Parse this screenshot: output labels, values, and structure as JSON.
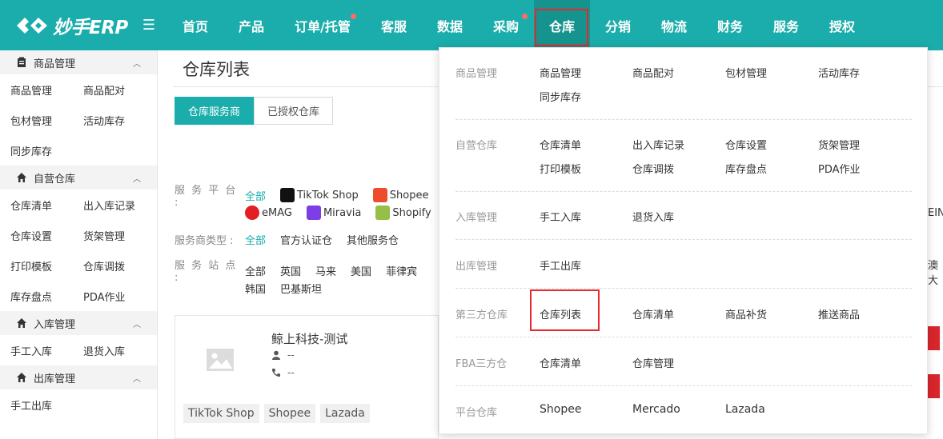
{
  "app": {
    "logo_text": "妙手ERP"
  },
  "nav": [
    {
      "label": "首页"
    },
    {
      "label": "产品"
    },
    {
      "label": "订单/托管"
    },
    {
      "label": "客服"
    },
    {
      "label": "数据"
    },
    {
      "label": "采购"
    },
    {
      "label": "仓库"
    },
    {
      "label": "分销"
    },
    {
      "label": "物流"
    },
    {
      "label": "财务"
    },
    {
      "label": "服务"
    },
    {
      "label": "授权"
    }
  ],
  "sidebar": {
    "sections": [
      {
        "title": "商品管理",
        "items": [
          "商品管理",
          "商品配对",
          "包材管理",
          "活动库存",
          "同步库存"
        ]
      },
      {
        "title": "自营仓库",
        "items": [
          "仓库清单",
          "出入库记录",
          "仓库设置",
          "货架管理",
          "打印模板",
          "仓库调拨",
          "库存盘点",
          "PDA作业"
        ]
      },
      {
        "title": "入库管理",
        "items": [
          "手工入库",
          "退货入库"
        ]
      },
      {
        "title": "出库管理",
        "items": [
          "手工出库"
        ]
      }
    ]
  },
  "main": {
    "page_title": "仓库列表",
    "tabs": [
      "仓库服务商",
      "已授权仓库"
    ],
    "filters": {
      "platform_label": "服 务 平 台 :",
      "platform_all": "全部",
      "platforms": [
        "TikTok Shop",
        "Shopee",
        "eMAG",
        "Miravia",
        "Shopify"
      ],
      "type_label": "服务商类型 :",
      "type_all": "全部",
      "types": [
        "官方认证仓",
        "其他服务仓"
      ],
      "site_label": "服 务 站 点 :",
      "sites": [
        "全部",
        "英国",
        "马来",
        "美国",
        "菲律宾",
        "韩国",
        "巴基斯坦"
      ]
    },
    "card": {
      "name": "鲸上科技-测试",
      "contact": "--",
      "phone": "--",
      "tags": [
        "TikTok Shop",
        "Shopee",
        "Lazada"
      ]
    },
    "edge_text": [
      "EIN",
      "澳大"
    ]
  },
  "dropdown": {
    "rows": [
      {
        "category": "商品管理",
        "items": [
          "商品管理",
          "商品配对",
          "包材管理",
          "活动库存",
          "同步库存"
        ]
      },
      {
        "category": "自营仓库",
        "items": [
          "仓库清单",
          "出入库记录",
          "仓库设置",
          "货架管理",
          "打印模板",
          "仓库调拨",
          "库存盘点",
          "PDA作业"
        ]
      },
      {
        "category": "入库管理",
        "items": [
          "手工入库",
          "退货入库"
        ]
      },
      {
        "category": "出库管理",
        "items": [
          "手工出库"
        ]
      },
      {
        "category": "第三方仓库",
        "items": [
          "仓库列表",
          "仓库清单",
          "商品补货",
          "推送商品"
        ]
      },
      {
        "category": "FBA三方仓",
        "items": [
          "仓库清单",
          "仓库管理"
        ]
      },
      {
        "category": "平台仓库",
        "items": [
          "Shopee",
          "Mercado",
          "Lazada"
        ]
      }
    ]
  },
  "colors": {
    "brand": "#1aadab",
    "highlight": "#e8282c"
  }
}
